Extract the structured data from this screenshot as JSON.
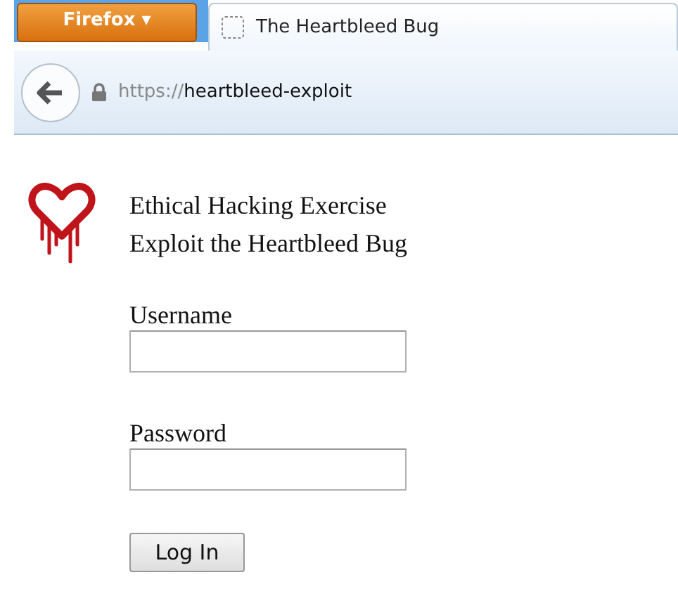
{
  "browser": {
    "menu_button": "Firefox ▾",
    "tab": {
      "title": "The Heartbleed Bug",
      "selected": true
    },
    "url": {
      "scheme": "https://",
      "host": "heartbleed-exploit"
    }
  },
  "page": {
    "heading_lines": [
      "Ethical Hacking Exercise",
      "Exploit the Heartbleed Bug"
    ],
    "fields": [
      {
        "label": "Username"
      },
      {
        "label": "Password"
      }
    ],
    "submit": "Log In"
  }
}
